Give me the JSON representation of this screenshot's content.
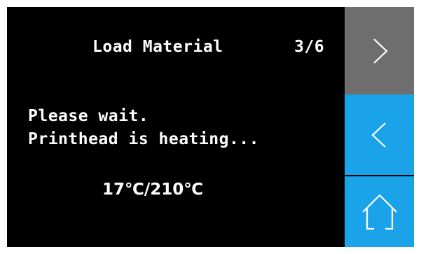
{
  "header": {
    "title": "Load Material",
    "step": "3/6"
  },
  "message": {
    "line1": "Please wait.",
    "line2": "Printhead is heating..."
  },
  "temperature": {
    "text": "17℃/210℃"
  },
  "sidebar": {
    "next": {
      "icon": "chevron-right-icon"
    },
    "back": {
      "icon": "chevron-left-icon"
    },
    "home": {
      "icon": "home-icon"
    }
  },
  "colors": {
    "background": "#000000",
    "text": "#ffffff",
    "next_button": "#6e6e6e",
    "back_button": "#1aa3e8",
    "home_button": "#1aa3e8",
    "icon_stroke": "#ffffff"
  }
}
